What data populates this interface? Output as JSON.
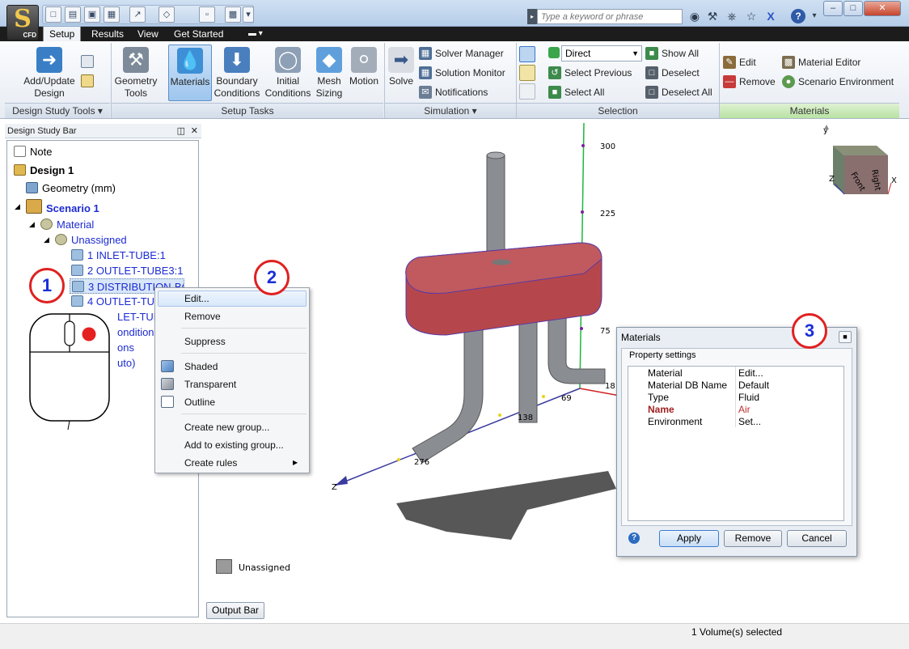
{
  "quick_access_toolbar": {
    "search_placeholder": "Type a keyword or phrase"
  },
  "app_badge": "CFD",
  "ribbon_tabs": [
    "Setup",
    "Results",
    "View",
    "Get Started"
  ],
  "ribbon": {
    "design_study_tools": {
      "add_update_design": "Add/Update Design",
      "footer": "Design Study Tools"
    },
    "setup_tasks": {
      "geometry_tools": "Geometry Tools",
      "materials": "Materials",
      "boundary_conditions": "Boundary Conditions",
      "initial_conditions": "Initial Conditions",
      "mesh_sizing": "Mesh Sizing",
      "motion": "Motion",
      "footer": "Setup Tasks"
    },
    "simulation": {
      "solve": "Solve",
      "solver_manager": "Solver Manager",
      "solution_monitor": "Solution Monitor",
      "notifications": "Notifications",
      "footer": "Simulation"
    },
    "selection": {
      "mode": "Direct",
      "select_previous": "Select Previous",
      "select_all": "Select All",
      "show_all": "Show All",
      "deselect": "Deselect",
      "deselect_all": "Deselect All",
      "footer": "Selection"
    },
    "materials": {
      "edit": "Edit",
      "remove": "Remove",
      "material_editor": "Material Editor",
      "scenario_environment": "Scenario Environment",
      "footer": "Materials"
    }
  },
  "design_study_bar": {
    "title": "Design Study Bar",
    "note": "Note",
    "design": "Design 1",
    "geometry": "Geometry (mm)",
    "scenario": "Scenario 1",
    "material": "Material",
    "unassigned": "Unassigned",
    "parts": [
      "1 INLET-TUBE:1",
      "2 OUTLET-TUBE3:1",
      "3 DISTRIBUTION-BO",
      "4 OUTLET-TUB"
    ],
    "partial_items": [
      "LET-TUBE",
      "onditions",
      "ons",
      "uto)"
    ]
  },
  "context_menu": {
    "items": [
      "Edit...",
      "Remove",
      "Suppress",
      "Shaded",
      "Transparent",
      "Outline",
      "Create new group...",
      "Add to existing group...",
      "Create rules"
    ]
  },
  "callouts": [
    "1",
    "2",
    "3"
  ],
  "viewport": {
    "axis_ticks": [
      "300",
      "225",
      "75",
      "18",
      "69",
      "138",
      "276"
    ],
    "axis_z": "Z",
    "axis_x": "X",
    "axis_y": "y",
    "cube_faces": [
      "Front",
      "Right"
    ],
    "cube_top": "Top",
    "legend_label": "Unassigned"
  },
  "materials_dialog": {
    "title": "Materials",
    "group_title": "Property settings",
    "rows": [
      {
        "key": "Material",
        "value": "Edit..."
      },
      {
        "key": "Material DB Name",
        "value": "Default"
      },
      {
        "key": "Type",
        "value": "Fluid"
      },
      {
        "key": "Name",
        "value": "Air"
      },
      {
        "key": "Environment",
        "value": "Set..."
      }
    ],
    "apply": "Apply",
    "remove": "Remove",
    "cancel": "Cancel"
  },
  "output_bar": "Output Bar",
  "status": "1 Volume(s) selected",
  "colors": {
    "accent_red": "#e02020",
    "callout_blue": "#1a2fd8",
    "tree_blue": "#1d2bd2",
    "part_color": "#b5474c",
    "name_highlight": "#a02020"
  }
}
